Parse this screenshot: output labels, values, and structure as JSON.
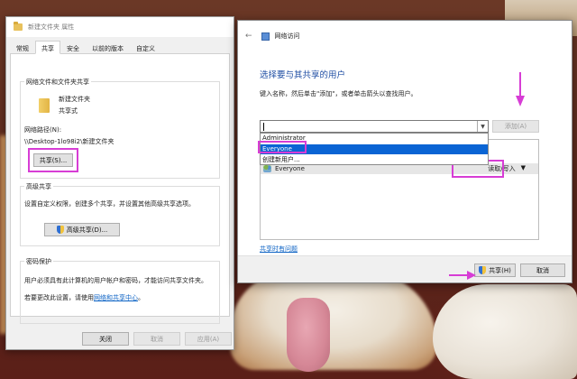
{
  "props_dialog": {
    "title": "新建文件夹 属性",
    "tabs": [
      "常规",
      "共享",
      "安全",
      "以前的版本",
      "自定义"
    ],
    "active_tab": "共享",
    "network_share_group": {
      "title": "网络文件和文件夹共享",
      "folder_name": "新建文件夹",
      "share_status": "共享式",
      "network_path_label": "网络路径(N):",
      "network_path": "\\\\Desktop-1lo98i2\\新建文件夹",
      "share_button": "共享(S)..."
    },
    "advanced_share_group": {
      "title": "高级共享",
      "description": "设置自定义权限，创建多个共享，并设置其他高级共享选项。",
      "button": "高级共享(D)..."
    },
    "password_group": {
      "title": "密码保护",
      "line1": "用户必须具有此计算机的用户帐户和密码，才能访问共享文件夹。",
      "line2_prefix": "若要更改此设置，请使用",
      "line2_link": "网络和共享中心",
      "line2_suffix": "。"
    },
    "footer": {
      "close": "关闭",
      "cancel": "取消",
      "apply": "应用(A)"
    }
  },
  "net_dialog": {
    "title": "网络访问",
    "heading": "选择要与其共享的用户",
    "instruction": "键入名称，然后单击\"添加\"，或者单击箭头以查找用户。",
    "add_button": "添加(A)",
    "dropdown_options": [
      "Administrator",
      "Everyone",
      "创建新用户..."
    ],
    "selected_option": "Everyone",
    "users": [
      {
        "name": "Everyone",
        "permission": "读取/写入"
      }
    ],
    "trouble_link": "共享时有问题",
    "share_button": "共享(H)",
    "cancel_button": "取消"
  },
  "colors": {
    "highlight": "#d73dd5",
    "selection": "#0a64d4",
    "link": "#0b62c4",
    "heading": "#1f4ea3"
  }
}
